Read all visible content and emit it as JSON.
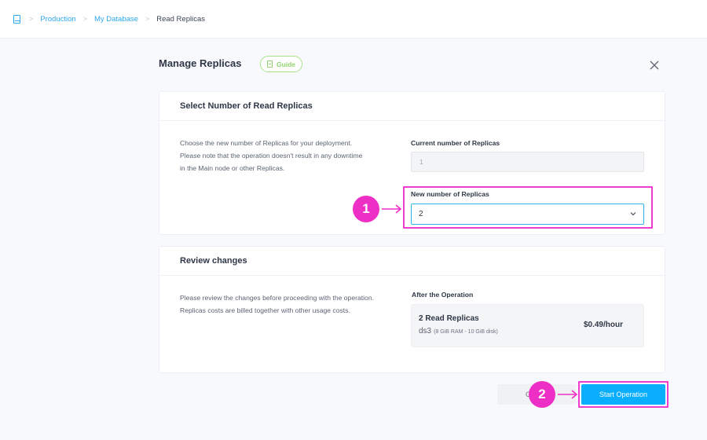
{
  "breadcrumb": {
    "icon": "book-icon",
    "items": [
      {
        "label": "Production",
        "link": true
      },
      {
        "label": "My Database",
        "link": true
      },
      {
        "label": "Read Replicas",
        "link": false
      }
    ],
    "separator": ">"
  },
  "header": {
    "title": "Manage Replicas",
    "guide_label": "Guide",
    "close_icon": "close-icon"
  },
  "select_section": {
    "title": "Select Number of Read Replicas",
    "description": "Choose the new number of Replicas for your deployment. Please note that the operation doesn't result in any downtime in the Main node or other Replicas.",
    "current_label": "Current number of Replicas",
    "current_value": "1",
    "new_label": "New number of Replicas",
    "new_value": "2"
  },
  "review_section": {
    "title": "Review changes",
    "description": "Please review the changes before proceeding with the operation. Replicas costs are billed together with other usage costs.",
    "after_label": "After the Operation",
    "summary": {
      "title": "2 Read Replicas",
      "plan": "ds3",
      "plan_detail": "(8 GiB RAM - 10 GiB disk)",
      "price": "$0.49/hour"
    }
  },
  "actions": {
    "cancel_label": "Cancel",
    "start_label": "Start Operation"
  },
  "annotations": {
    "step1": "1",
    "step2": "2",
    "color": "#ee2fc6"
  },
  "colors": {
    "accent": "#0aaeff",
    "link": "#2ea8f0",
    "guide": "#8fd36c",
    "highlight": "#f03ccf"
  }
}
